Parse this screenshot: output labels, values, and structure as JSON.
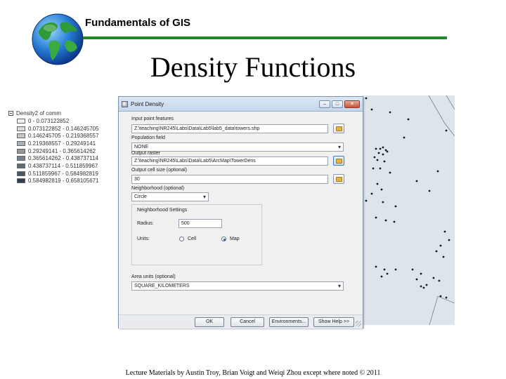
{
  "slide": {
    "course_title": "Fundamentals of GIS",
    "title": "Density Functions",
    "footer": "Lecture Materials by Austin Troy, Brian Voigt and Weiqi Zhou except where noted © 2011"
  },
  "legend": {
    "layer_name": "Density2 of comm",
    "classes": [
      {
        "label": "0 - 0.073122852",
        "color": "#f2f2f2"
      },
      {
        "label": "0.073122852 - 0.146245705",
        "color": "#d9dde1"
      },
      {
        "label": "0.146245705 - 0.219368557",
        "color": "#c1c7cd"
      },
      {
        "label": "0.219368557 - 0.29249141",
        "color": "#a8b0b8"
      },
      {
        "label": "0.29249141 - 0.365614262",
        "color": "#8f99a3"
      },
      {
        "label": "0.365614262 - 0.438737114",
        "color": "#77838f"
      },
      {
        "label": "0.438737114 - 0.511859967",
        "color": "#5f6c79"
      },
      {
        "label": "0.511859967 - 0.584982819",
        "color": "#485562"
      },
      {
        "label": "0.584982819 - 0.658105671",
        "color": "#323e4b"
      }
    ]
  },
  "dialog": {
    "title": "Point Density",
    "window_buttons": {
      "minimize": "–",
      "maximize": "□",
      "close": "✕"
    },
    "input_features": {
      "label": "Input point features",
      "value": "Z:\\teaching\\NR245\\Labs\\Data\\Lab5\\lab5_data\\towers.shp"
    },
    "population_field": {
      "label": "Population field",
      "value": "NONE"
    },
    "output_raster": {
      "label": "Output raster",
      "value": "Z:\\teaching\\NR245\\Labs\\Data\\Lab5\\ArcMap\\TowerDens"
    },
    "cell_size": {
      "label": "Output cell size (optional)",
      "value": "30"
    },
    "neighborhood": {
      "label": "Neighborhood (optional)",
      "value": "Circle"
    },
    "neighborhood_settings": {
      "label": "Neighborhood Settings",
      "radius_label": "Radius:",
      "radius_value": "500",
      "units_label": "Units:",
      "cell_label": "Cell",
      "map_label": "Map",
      "selected": "Map"
    },
    "area_units": {
      "label": "Area units (optional)",
      "value": "SQUARE_KILOMETERS"
    },
    "buttons": {
      "ok": "OK",
      "cancel": "Cancel",
      "environments": "Environments...",
      "help": "Show Help >>"
    }
  },
  "icons": {
    "globe": "globe-icon",
    "folder": "folder-open-icon"
  },
  "colors": {
    "title_rule": "#1f8a2a",
    "map_bg": "#dde5ea",
    "points": "#0d1a2a"
  }
}
